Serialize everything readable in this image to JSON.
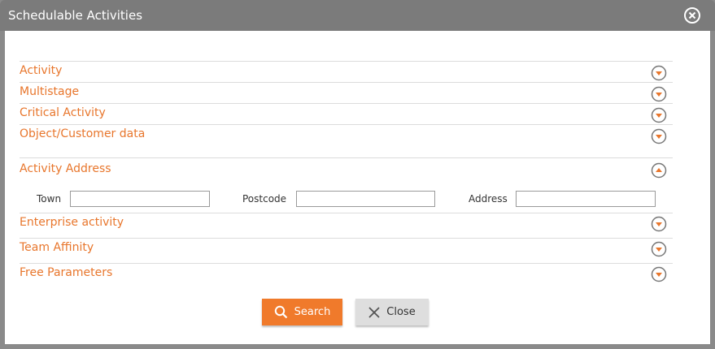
{
  "dialog": {
    "title": "Schedulable Activities",
    "close_icon": "close-circle-icon"
  },
  "sections": [
    {
      "label": "Activity",
      "state": "collapsed"
    },
    {
      "label": "Multistage",
      "state": "collapsed"
    },
    {
      "label": "Critical Activity",
      "state": "collapsed"
    },
    {
      "label": "Object/Customer data",
      "state": "collapsed"
    },
    {
      "label": "Activity Address",
      "state": "expanded"
    },
    {
      "label": "Enterprise activity",
      "state": "collapsed"
    },
    {
      "label": "Team Affinity",
      "state": "collapsed"
    },
    {
      "label": "Free Parameters",
      "state": "collapsed"
    }
  ],
  "address_fields": {
    "town": {
      "label": "Town",
      "value": ""
    },
    "postcode": {
      "label": "Postcode",
      "value": ""
    },
    "address": {
      "label": "Address",
      "value": ""
    }
  },
  "buttons": {
    "search_label": "Search",
    "close_label": "Close"
  },
  "colors": {
    "accent": "#e8762c",
    "search_button": "#f07a2b",
    "titlebar": "#7b7b7b"
  }
}
